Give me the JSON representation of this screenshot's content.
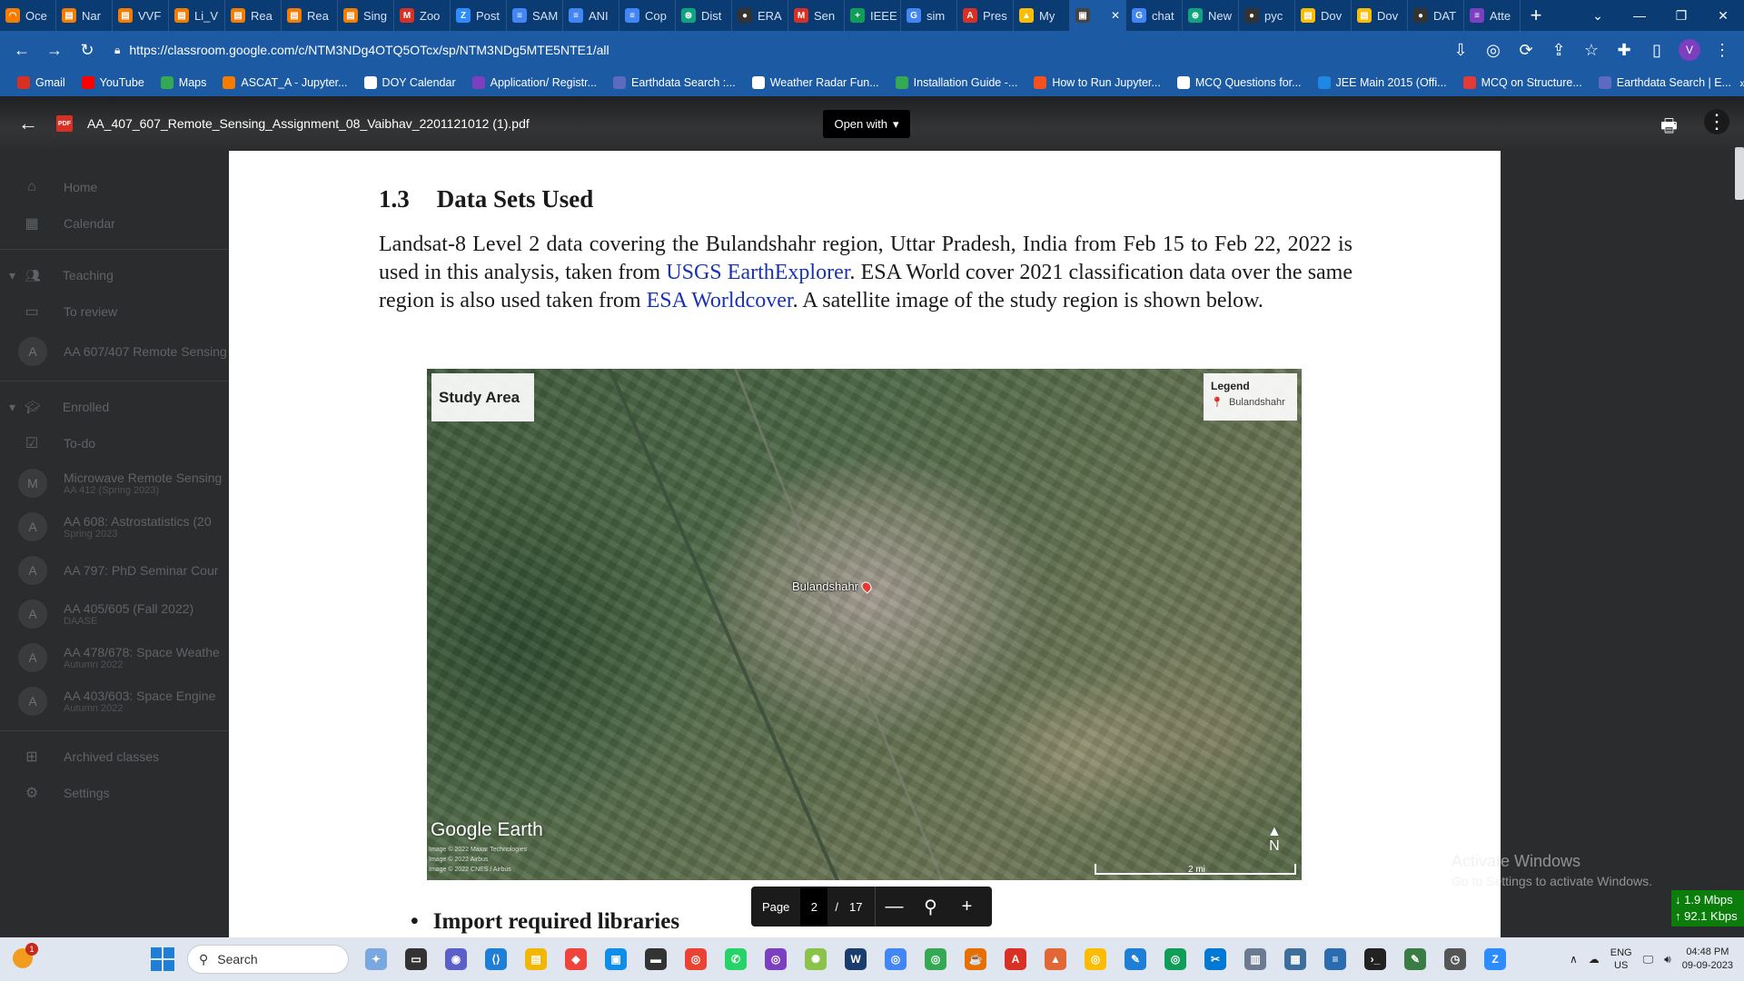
{
  "browser": {
    "tabs": [
      {
        "label": "Oce",
        "color": "#f57c00",
        "glyph": "◠"
      },
      {
        "label": "Nar",
        "color": "#f57c00",
        "glyph": "▤"
      },
      {
        "label": "VVF",
        "color": "#f57c00",
        "glyph": "▤"
      },
      {
        "label": "Li_V",
        "color": "#f57c00",
        "glyph": "▤"
      },
      {
        "label": "Rea",
        "color": "#f57c00",
        "glyph": "▤"
      },
      {
        "label": "Rea",
        "color": "#f57c00",
        "glyph": "▤"
      },
      {
        "label": "Sing",
        "color": "#f57c00",
        "glyph": "▤"
      },
      {
        "label": "Zoo",
        "color": "#d93025",
        "glyph": "M"
      },
      {
        "label": "Post",
        "color": "#2d8cff",
        "glyph": "Z"
      },
      {
        "label": "SAM",
        "color": "#4285f4",
        "glyph": "≡"
      },
      {
        "label": "ANI",
        "color": "#4285f4",
        "glyph": "≡"
      },
      {
        "label": "Cop",
        "color": "#4285f4",
        "glyph": "≡"
      },
      {
        "label": "Dist",
        "color": "#10a37f",
        "glyph": "⊛"
      },
      {
        "label": "ERA",
        "color": "#333333",
        "glyph": "●"
      },
      {
        "label": "Sen",
        "color": "#d93025",
        "glyph": "M"
      },
      {
        "label": "IEEE",
        "color": "#0f9d58",
        "glyph": "+"
      },
      {
        "label": "sim",
        "color": "#4285f4",
        "glyph": "G"
      },
      {
        "label": "Pres",
        "color": "#d93025",
        "glyph": "A"
      },
      {
        "label": "My",
        "color": "#fbbc04",
        "glyph": "▲"
      },
      {
        "label": "",
        "color": "#444444",
        "glyph": "▣",
        "active": true
      },
      {
        "label": "chat",
        "color": "#4285f4",
        "glyph": "G"
      },
      {
        "label": "New",
        "color": "#10a37f",
        "glyph": "⊛"
      },
      {
        "label": "pyc",
        "color": "#333333",
        "glyph": "●"
      },
      {
        "label": "Dov",
        "color": "#fbbc04",
        "glyph": "▤"
      },
      {
        "label": "Dov",
        "color": "#fbbc04",
        "glyph": "▤"
      },
      {
        "label": "DAT",
        "color": "#333333",
        "glyph": "●"
      },
      {
        "label": "Atte",
        "color": "#7b3fbf",
        "glyph": "≡"
      }
    ],
    "url": "https://classroom.google.com/c/NTM3NDg4OTQ5OTcx/sp/NTM3NDg5MTE5NTE1/all",
    "profile_initial": "V",
    "bookmarks": [
      {
        "label": "Gmail",
        "color": "#d93025"
      },
      {
        "label": "YouTube",
        "color": "#ff0000"
      },
      {
        "label": "Maps",
        "color": "#34a853"
      },
      {
        "label": "ASCAT_A - Jupyter...",
        "color": "#f57c00"
      },
      {
        "label": "DOY Calendar",
        "color": "#ffffff"
      },
      {
        "label": "Application/ Registr...",
        "color": "#7b3fbf"
      },
      {
        "label": "Earthdata Search :...",
        "color": "#5c6bc0"
      },
      {
        "label": "Weather Radar Fun...",
        "color": "#ffffff"
      },
      {
        "label": "Installation Guide -...",
        "color": "#34a853"
      },
      {
        "label": "How to Run Jupyter...",
        "color": "#f4511e"
      },
      {
        "label": "MCQ Questions for...",
        "color": "#ffffff"
      },
      {
        "label": "JEE Main 2015 (Offi...",
        "color": "#1e88e5"
      },
      {
        "label": "MCQ on Structure...",
        "color": "#e53935"
      },
      {
        "label": "Earthdata Search | E...",
        "color": "#5c6bc0"
      }
    ],
    "bookmarks_more": "»"
  },
  "classroom": {
    "top": [
      {
        "label": "Home",
        "icon": "⌂"
      },
      {
        "label": "Calendar",
        "icon": "▦"
      }
    ],
    "teaching_label": "Teaching",
    "to_review": "To review",
    "teaching_course": {
      "initial": "A",
      "name": "AA 607/407 Remote Sensing"
    },
    "enrolled_label": "Enrolled",
    "todo": "To-do",
    "courses": [
      {
        "initial": "M",
        "name": "Microwave Remote Sensing",
        "sub": "AA 412 (Spring 2023)"
      },
      {
        "initial": "A",
        "name": "AA 608: Astrostatistics (20",
        "sub": "Spring 2023"
      },
      {
        "initial": "A",
        "name": "AA 797: PhD Seminar Cour",
        "sub": ""
      },
      {
        "initial": "A",
        "name": "AA 405/605 (Fall 2022)",
        "sub": "DAASE"
      },
      {
        "initial": "A",
        "name": "AA 478/678: Space Weathe",
        "sub": "Autumn 2022"
      },
      {
        "initial": "A",
        "name": "AA 403/603: Space Engine",
        "sub": "Autumn 2022"
      }
    ],
    "archived": "Archived classes",
    "settings": "Settings"
  },
  "viewer": {
    "file_name": "AA_407_607_Remote_Sensing_Assignment_08_Vaibhav_2201121012 (1).pdf",
    "pdf_badge": "PDF",
    "open_with": "Open with",
    "page_label": "Page",
    "current_page": "2",
    "separator": "/",
    "total_pages": "17"
  },
  "document": {
    "section_number": "1.3",
    "section_title": "Data Sets Used",
    "para_1": "Landsat-8 Level 2 data covering the Bulandshahr region, Uttar Pradesh, India from Feb 15 to Feb 22, 2022 is used in this analysis, taken from ",
    "link_1": "USGS EarthExplorer",
    "para_2": ". ESA World cover 2021 classification data over the same region is also used taken from ",
    "link_2": "ESA Worldcover",
    "para_3": ". A satellite image of the study region is shown below.",
    "figure": {
      "title": "Study Area",
      "legend_title": "Legend",
      "legend_item": "Bulandshahr",
      "place_label": "Bulandshahr",
      "watermark": "Google Earth",
      "credit_1": "Image © 2022 Maxar Technologies",
      "credit_2": "Image © 2022 Airbus",
      "credit_3": "Image © 2022 CNES / Airbus",
      "north": "N",
      "scale": "2 mi"
    },
    "bullet_text": "Import required libraries"
  },
  "windows": {
    "activate_title": "Activate Windows",
    "activate_sub": "Go to Settings to activate Windows.",
    "net_down": "↓ 1.9 Mbps",
    "net_up": "↑ 92.1 Kbps",
    "search_label": "Search",
    "weather_badge": "1",
    "lang_1": "ENG",
    "lang_2": "US",
    "time": "04:48 PM",
    "date": "09-09-2023"
  }
}
